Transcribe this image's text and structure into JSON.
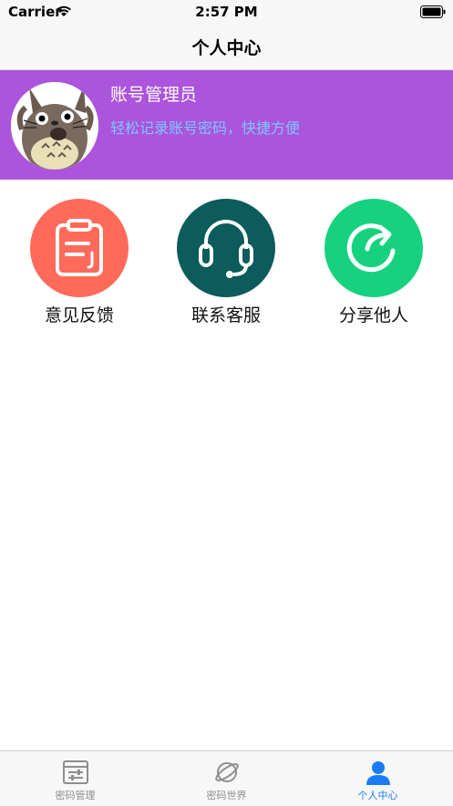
{
  "status_bar": {
    "carrier": "Carrier",
    "time": "2:57 PM"
  },
  "nav": {
    "title": "个人中心"
  },
  "profile": {
    "name": "账号管理员",
    "subtitle": "轻松记录账号密码，快捷方便"
  },
  "actions": [
    {
      "label": "意见反馈",
      "icon": "clipboard-icon",
      "color": "#ff6a5a"
    },
    {
      "label": "联系客服",
      "icon": "headset-icon",
      "color": "#0b5c5a"
    },
    {
      "label": "分享他人",
      "icon": "share-arrow-icon",
      "color": "#16d27e"
    }
  ],
  "tabs": [
    {
      "label": "密码管理",
      "icon": "keyboard-settings-icon",
      "active": false
    },
    {
      "label": "密码世界",
      "icon": "planet-icon",
      "active": false
    },
    {
      "label": "个人中心",
      "icon": "person-icon",
      "active": true
    }
  ],
  "colors": {
    "profile_bg": "#ab54dc",
    "subtitle": "#7ec6ff",
    "tab_active": "#1a7cf5",
    "tab_inactive": "#8e8e8e"
  }
}
